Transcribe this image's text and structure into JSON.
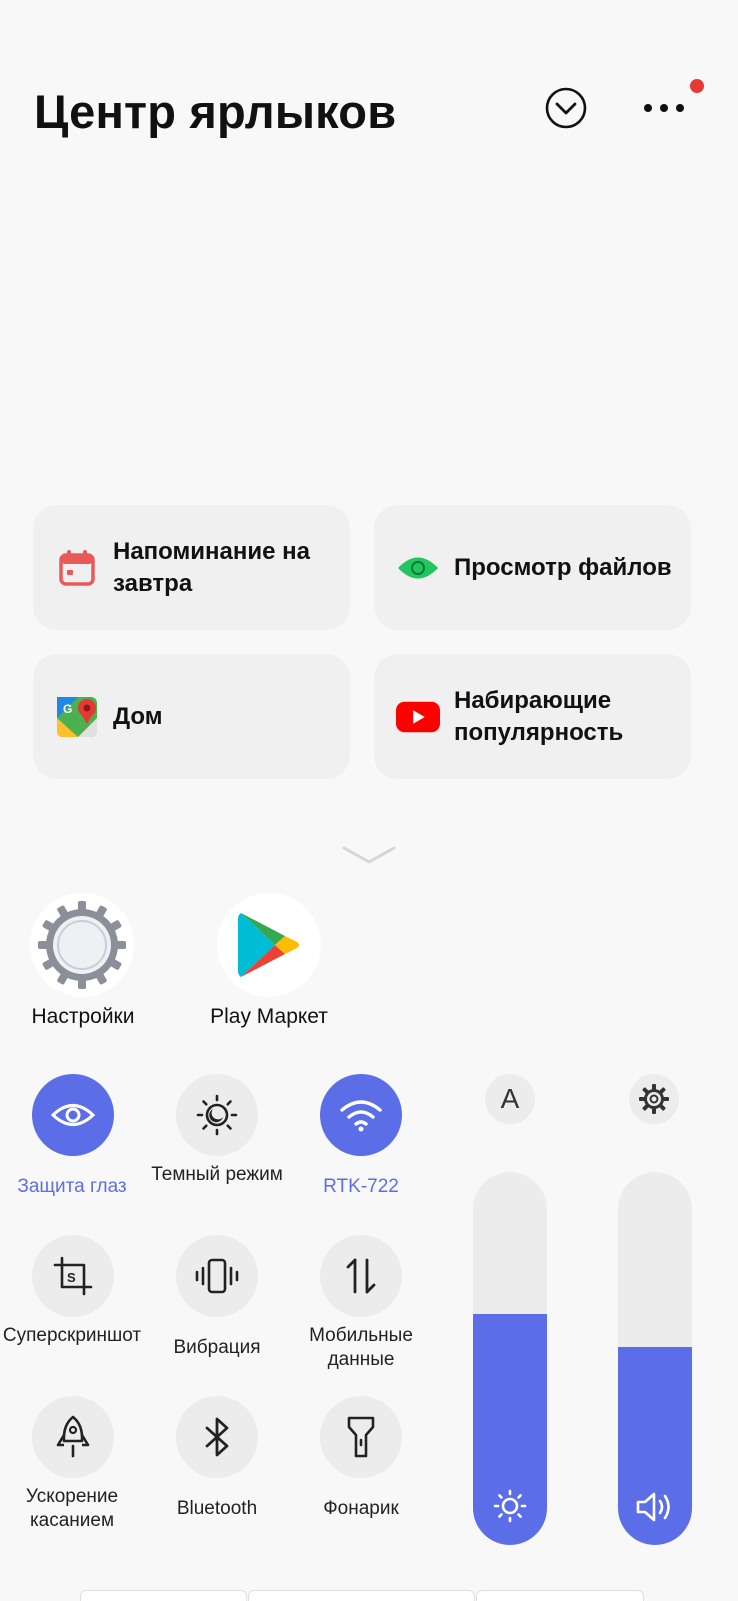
{
  "header": {
    "title": "Центр ярлыков"
  },
  "shortcuts": [
    {
      "label": "Напоминание на завтра",
      "icon": "calendar-icon"
    },
    {
      "label": "Просмотр файлов",
      "icon": "eye-icon"
    },
    {
      "label": "Дом",
      "icon": "google-maps-icon"
    },
    {
      "label": "Набирающие популярность",
      "icon": "youtube-icon"
    }
  ],
  "apps": [
    {
      "label": "Настройки",
      "icon": "settings-gear-icon"
    },
    {
      "label": "Play Маркет",
      "icon": "play-store-icon"
    }
  ],
  "toggles": [
    {
      "label": "Защита глаз",
      "active": true,
      "icon": "eye-icon"
    },
    {
      "label": "Темный режим",
      "active": false,
      "icon": "dark-mode-icon"
    },
    {
      "label": "RTK-722",
      "active": true,
      "icon": "wifi-icon"
    },
    {
      "label": "Суперскриншот",
      "active": false,
      "icon": "screenshot-crop-icon"
    },
    {
      "label": "Вибрация",
      "active": false,
      "icon": "vibration-icon"
    },
    {
      "label": "Мобильные данные",
      "active": false,
      "icon": "mobile-data-icon"
    },
    {
      "label": "Ускорение касанием",
      "active": false,
      "icon": "rocket-icon"
    },
    {
      "label": "Bluetooth",
      "active": false,
      "icon": "bluetooth-icon"
    },
    {
      "label": "Фонарик",
      "active": false,
      "icon": "flashlight-icon"
    }
  ],
  "sliders": {
    "auto_brightness_label": "A",
    "brightness_level": 0.62,
    "volume_level": 0.53
  },
  "colors": {
    "accent": "#5b6ee8",
    "notification_dot": "#e53935"
  }
}
